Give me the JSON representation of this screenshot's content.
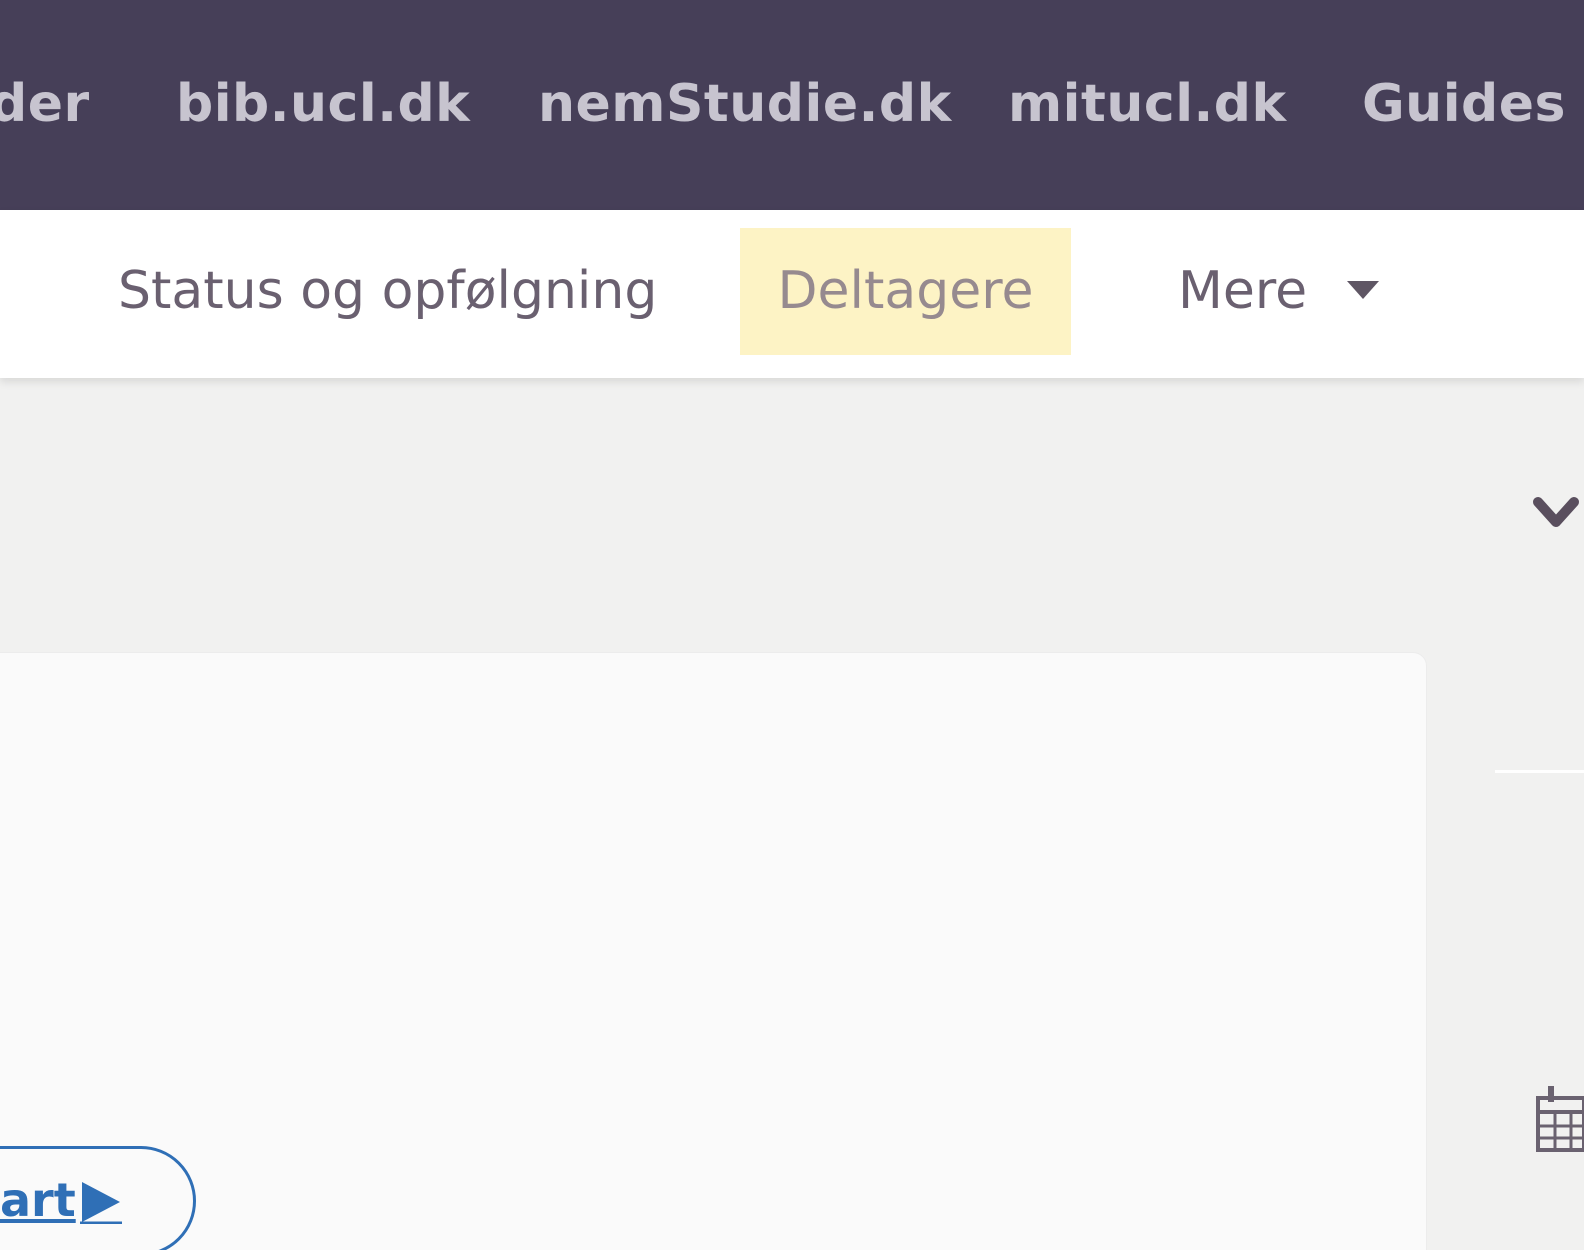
{
  "top_nav": {
    "links": [
      "der",
      "bib.ucl.dk",
      "nemStudie.dk",
      "mitucl.dk",
      "Guides"
    ]
  },
  "sub_nav": {
    "tabs": [
      "Status og opfølgning",
      "Deltagere",
      "Mere"
    ],
    "active_tab": "Deltagere"
  },
  "card": {
    "start_label": "art"
  },
  "colors": {
    "topbar_bg": "#463f58",
    "topbar_text": "#c7c4cf",
    "active_tab_bg": "#fdf3c5",
    "link_blue": "#2f6fb6",
    "page_bg": "#f1f1f0"
  },
  "icons": {
    "dropdown": "caret-down-icon",
    "side_toggle": "chevron-down-icon",
    "calendar": "calendar-icon",
    "play": "play-icon"
  }
}
